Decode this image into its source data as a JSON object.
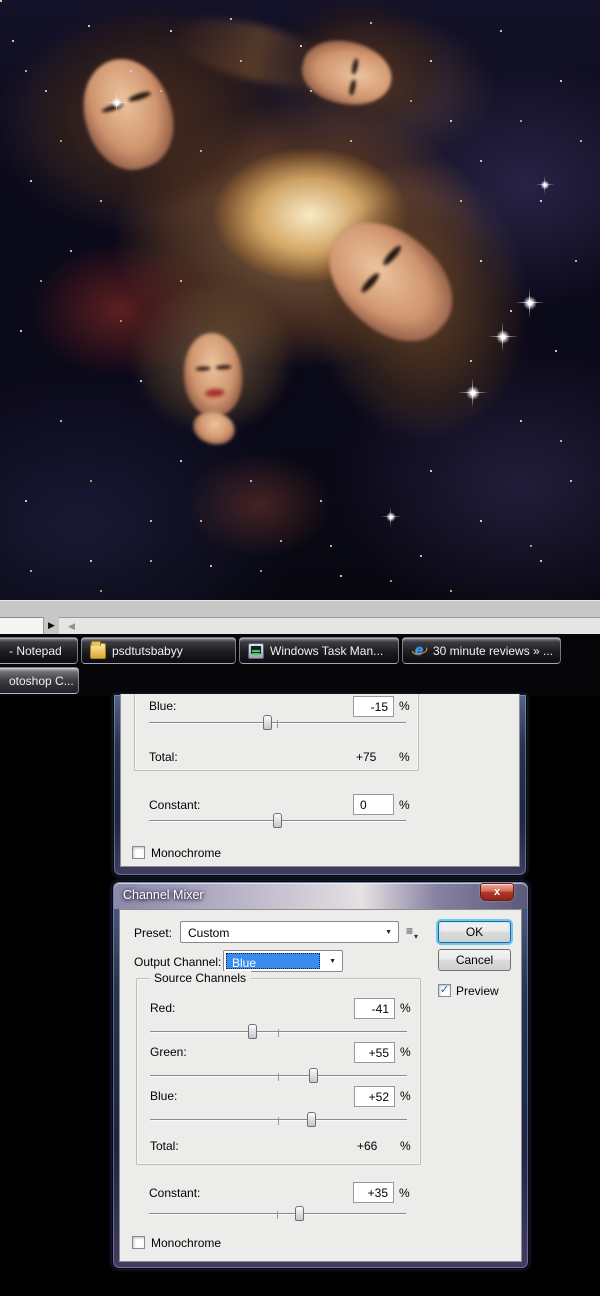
{
  "taskbar": {
    "row1": [
      {
        "label": "- Notepad",
        "icon": "none"
      },
      {
        "label": "psdtutsbabyy",
        "icon": "folder"
      },
      {
        "label": "Windows Task Man...",
        "icon": "task-manager"
      },
      {
        "label": "30 minute reviews » ...",
        "icon": "internet-explorer"
      }
    ],
    "row2": [
      {
        "label": "otoshop C...",
        "icon": "none"
      }
    ]
  },
  "icons": {
    "scroll_right": "▶",
    "scroll_left": "◀",
    "combo_arrow": "▼",
    "close": "x",
    "preset_list": "≡",
    "check": "✓",
    "ie_letter": "e"
  },
  "dialog_partial": {
    "rows": {
      "blue": {
        "label": "Blue:",
        "value": "-15",
        "unit": "%"
      },
      "total": {
        "label": "Total:",
        "value": "+75",
        "unit": "%"
      },
      "constant": {
        "label": "Constant:",
        "value": "0",
        "unit": "%"
      }
    },
    "monochrome_label": "Monochrome"
  },
  "channel_mixer": {
    "title": "Channel Mixer",
    "preset_label": "Preset:",
    "preset_value": "Custom",
    "output_channel_label": "Output Channel:",
    "output_channel_value": "Blue",
    "ok_label": "OK",
    "cancel_label": "Cancel",
    "preview_label": "Preview",
    "source_channels_label": "Source Channels",
    "rows": {
      "red": {
        "label": "Red:",
        "value": "-41",
        "unit": "%"
      },
      "green": {
        "label": "Green:",
        "value": "+55",
        "unit": "%"
      },
      "blue": {
        "label": "Blue:",
        "value": "+52",
        "unit": "%"
      },
      "total": {
        "label": "Total:",
        "value": "+66",
        "unit": "%"
      },
      "constant": {
        "label": "Constant:",
        "value": "+35",
        "unit": "%"
      }
    },
    "monochrome_label": "Monochrome"
  },
  "colors": {
    "selection_blue": "#3a8bf0",
    "close_button_red": "#b23a28",
    "default_button_glow": "#6fc8f0",
    "dialog_bg": "#ececea"
  }
}
